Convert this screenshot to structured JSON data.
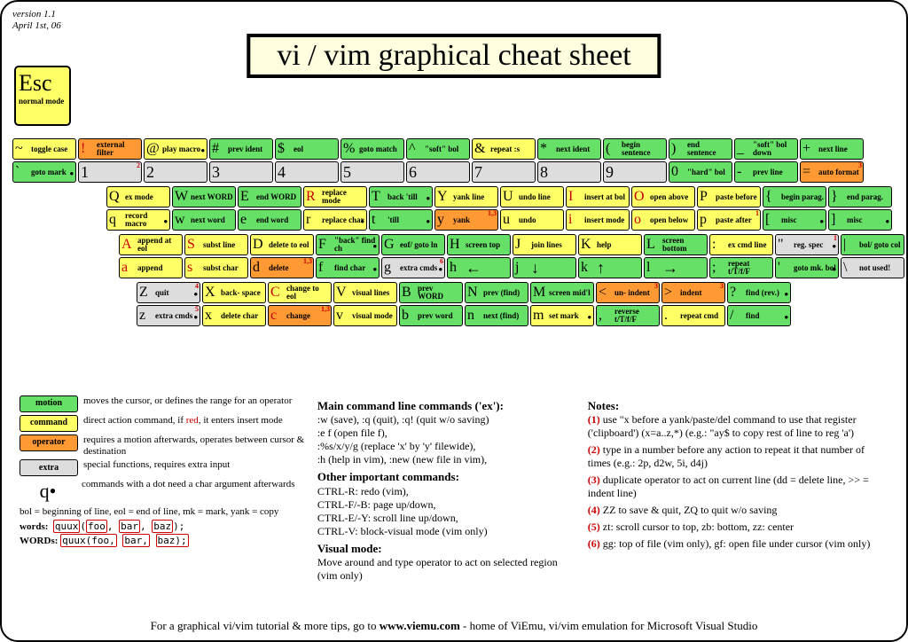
{
  "version": "version 1.1",
  "date": "April 1st, 06",
  "title": "vi / vim graphical cheat sheet",
  "esc": {
    "big": "Esc",
    "sm": "normal mode"
  },
  "rows": [
    {
      "ind": "",
      "keys": [
        {
          "t": [
            {
              "c": "~",
              "l": "toggle case",
              "cls": "y"
            }
          ],
          "b": [
            {
              "c": "`",
              "l": "goto mark",
              "cls": "g",
              "dot": 1
            }
          ]
        },
        {
          "t": [
            {
              "c": "!",
              "l": "external filter",
              "cls": "o",
              "red": 1
            }
          ],
          "tall": {
            "c": "1",
            "cls": "gr",
            "sup": "2"
          }
        },
        {
          "t": [
            {
              "c": "@",
              "l": "play macro",
              "cls": "y",
              "dot": 1
            }
          ],
          "tall": {
            "c": "2",
            "cls": "gr"
          }
        },
        {
          "t": [
            {
              "c": "#",
              "l": "prev ident",
              "cls": "g"
            }
          ],
          "tall": {
            "c": "3",
            "cls": "gr"
          }
        },
        {
          "t": [
            {
              "c": "$",
              "l": "eol",
              "cls": "g"
            }
          ],
          "tall": {
            "c": "4",
            "cls": "gr"
          }
        },
        {
          "t": [
            {
              "c": "%",
              "l": "goto match",
              "cls": "g"
            }
          ],
          "tall": {
            "c": "5",
            "cls": "gr"
          }
        },
        {
          "t": [
            {
              "c": "^",
              "l": "\"soft\" bol",
              "cls": "g"
            }
          ],
          "tall": {
            "c": "6",
            "cls": "gr"
          }
        },
        {
          "t": [
            {
              "c": "&",
              "l": "repeat :s",
              "cls": "y"
            }
          ],
          "tall": {
            "c": "7",
            "cls": "gr"
          }
        },
        {
          "t": [
            {
              "c": "*",
              "l": "next ident",
              "cls": "g"
            }
          ],
          "tall": {
            "c": "8",
            "cls": "gr"
          }
        },
        {
          "t": [
            {
              "c": "(",
              "l": "begin sentence",
              "cls": "g"
            }
          ],
          "tall": {
            "c": "9",
            "cls": "gr"
          }
        },
        {
          "t": [
            {
              "c": ")",
              "l": "end sentence",
              "cls": "g"
            }
          ],
          "b": [
            {
              "c": "0",
              "l": "\"hard\" bol",
              "cls": "g"
            }
          ]
        },
        {
          "t": [
            {
              "c": "_",
              "l": "\"soft\" bol down",
              "cls": "g"
            }
          ],
          "b": [
            {
              "c": "-",
              "l": "prev line",
              "cls": "g"
            }
          ]
        },
        {
          "t": [
            {
              "c": "+",
              "l": "next line",
              "cls": "g"
            }
          ],
          "b": [
            {
              "c": "=",
              "l": "auto format",
              "cls": "o",
              "sup": "3"
            }
          ]
        }
      ]
    },
    {
      "ind": "i1",
      "keys": [
        {
          "t": [
            {
              "c": "Q",
              "l": "ex mode",
              "cls": "y"
            }
          ],
          "b": [
            {
              "c": "q",
              "l": "record macro",
              "cls": "y",
              "dot": 1
            }
          ]
        },
        {
          "t": [
            {
              "c": "W",
              "l": "next WORD",
              "cls": "g"
            }
          ],
          "b": [
            {
              "c": "w",
              "l": "next word",
              "cls": "g"
            }
          ]
        },
        {
          "t": [
            {
              "c": "E",
              "l": "end WORD",
              "cls": "g"
            }
          ],
          "b": [
            {
              "c": "e",
              "l": "end word",
              "cls": "g"
            }
          ]
        },
        {
          "t": [
            {
              "c": "R",
              "l": "replace mode",
              "cls": "y",
              "red": 1
            }
          ],
          "b": [
            {
              "c": "r",
              "l": "replace char",
              "cls": "y",
              "dot": 1
            }
          ]
        },
        {
          "t": [
            {
              "c": "T",
              "l": "back 'till",
              "cls": "g",
              "dot": 1
            }
          ],
          "b": [
            {
              "c": "t",
              "l": "'till",
              "cls": "g",
              "dot": 1
            }
          ]
        },
        {
          "t": [
            {
              "c": "Y",
              "l": "yank line",
              "cls": "y"
            }
          ],
          "b": [
            {
              "c": "y",
              "l": "yank",
              "cls": "o",
              "sup": "1,3"
            }
          ]
        },
        {
          "t": [
            {
              "c": "U",
              "l": "undo line",
              "cls": "y"
            }
          ],
          "b": [
            {
              "c": "u",
              "l": "undo",
              "cls": "y"
            }
          ]
        },
        {
          "t": [
            {
              "c": "I",
              "l": "insert at bol",
              "cls": "y",
              "red": 1
            }
          ],
          "b": [
            {
              "c": "i",
              "l": "insert mode",
              "cls": "y",
              "red": 1
            }
          ]
        },
        {
          "t": [
            {
              "c": "O",
              "l": "open above",
              "cls": "y",
              "red": 1
            }
          ],
          "b": [
            {
              "c": "o",
              "l": "open below",
              "cls": "y",
              "red": 1
            }
          ]
        },
        {
          "t": [
            {
              "c": "P",
              "l": "paste before",
              "cls": "y"
            }
          ],
          "b": [
            {
              "c": "p",
              "l": "paste after",
              "cls": "y",
              "sup": "1"
            }
          ]
        },
        {
          "t": [
            {
              "c": "{",
              "l": "begin parag.",
              "cls": "g"
            }
          ],
          "b": [
            {
              "c": "[",
              "l": "misc",
              "cls": "g",
              "dot": 1
            }
          ]
        },
        {
          "t": [
            {
              "c": "}",
              "l": "end parag.",
              "cls": "g"
            }
          ],
          "b": [
            {
              "c": "]",
              "l": "misc",
              "cls": "g",
              "dot": 1
            }
          ]
        }
      ]
    },
    {
      "ind": "i2",
      "keys": [
        {
          "t": [
            {
              "c": "A",
              "l": "append at eol",
              "cls": "y",
              "red": 1
            }
          ],
          "b": [
            {
              "c": "a",
              "l": "append",
              "cls": "y",
              "red": 1
            }
          ]
        },
        {
          "t": [
            {
              "c": "S",
              "l": "subst line",
              "cls": "y",
              "red": 1
            }
          ],
          "b": [
            {
              "c": "s",
              "l": "subst char",
              "cls": "y",
              "red": 1
            }
          ]
        },
        {
          "t": [
            {
              "c": "D",
              "l": "delete to eol",
              "cls": "y"
            }
          ],
          "b": [
            {
              "c": "d",
              "l": "delete",
              "cls": "o",
              "sup": "1,3"
            }
          ]
        },
        {
          "t": [
            {
              "c": "F",
              "l": "\"back\" find ch",
              "cls": "g",
              "dot": 1
            }
          ],
          "b": [
            {
              "c": "f",
              "l": "find char",
              "cls": "g",
              "dot": 1
            }
          ]
        },
        {
          "t": [
            {
              "c": "G",
              "l": "eof/ goto ln",
              "cls": "g"
            }
          ],
          "b": [
            {
              "c": "g",
              "l": "extra cmds",
              "cls": "gr",
              "dot": 1,
              "sup": "6"
            }
          ]
        },
        {
          "t": [
            {
              "c": "H",
              "l": "screen top",
              "cls": "g"
            }
          ],
          "b": [
            {
              "c": "h",
              "l": "←",
              "cls": "g",
              "arrow": 1
            }
          ]
        },
        {
          "t": [
            {
              "c": "J",
              "l": "join lines",
              "cls": "y"
            }
          ],
          "b": [
            {
              "c": "j",
              "l": "↓",
              "cls": "g",
              "arrow": 1
            }
          ]
        },
        {
          "t": [
            {
              "c": "K",
              "l": "help",
              "cls": "y"
            }
          ],
          "b": [
            {
              "c": "k",
              "l": "↑",
              "cls": "g",
              "arrow": 1
            }
          ]
        },
        {
          "t": [
            {
              "c": "L",
              "l": "screen bottom",
              "cls": "g"
            }
          ],
          "b": [
            {
              "c": "l",
              "l": "→",
              "cls": "g",
              "arrow": 1
            }
          ]
        },
        {
          "t": [
            {
              "c": ":",
              "l": "ex cmd line",
              "cls": "y"
            }
          ],
          "b": [
            {
              "c": ";",
              "l": "repeat t/T/f/F",
              "cls": "g"
            }
          ]
        },
        {
          "t": [
            {
              "c": "\"",
              "l": "reg. spec",
              "cls": "gr",
              "dot": 1,
              "sup": "1"
            }
          ],
          "b": [
            {
              "c": "'",
              "l": "goto mk. bol",
              "cls": "g",
              "dot": 1
            }
          ]
        },
        {
          "t": [
            {
              "c": "|",
              "l": "bol/ goto col",
              "cls": "g"
            }
          ],
          "b": [
            {
              "c": "\\",
              "l": "not used!",
              "cls": "gr"
            }
          ]
        }
      ]
    },
    {
      "ind": "i3",
      "keys": [
        {
          "t": [
            {
              "c": "Z",
              "l": "quit",
              "cls": "gr",
              "dot": 1,
              "sup": "4"
            }
          ],
          "b": [
            {
              "c": "z",
              "l": "extra cmds",
              "cls": "gr",
              "dot": 1,
              "sup": "5"
            }
          ]
        },
        {
          "t": [
            {
              "c": "X",
              "l": "back- space",
              "cls": "y"
            }
          ],
          "b": [
            {
              "c": "x",
              "l": "delete char",
              "cls": "y"
            }
          ]
        },
        {
          "t": [
            {
              "c": "C",
              "l": "change to eol",
              "cls": "y",
              "red": 1
            }
          ],
          "b": [
            {
              "c": "c",
              "l": "change",
              "cls": "o",
              "red": 1,
              "sup": "1,3"
            }
          ]
        },
        {
          "t": [
            {
              "c": "V",
              "l": "visual lines",
              "cls": "y"
            }
          ],
          "b": [
            {
              "c": "v",
              "l": "visual mode",
              "cls": "y"
            }
          ]
        },
        {
          "t": [
            {
              "c": "B",
              "l": "prev WORD",
              "cls": "g"
            }
          ],
          "b": [
            {
              "c": "b",
              "l": "prev word",
              "cls": "g"
            }
          ]
        },
        {
          "t": [
            {
              "c": "N",
              "l": "prev (find)",
              "cls": "g"
            }
          ],
          "b": [
            {
              "c": "n",
              "l": "next (find)",
              "cls": "g"
            }
          ]
        },
        {
          "t": [
            {
              "c": "M",
              "l": "screen mid'l",
              "cls": "g"
            }
          ],
          "b": [
            {
              "c": "m",
              "l": "set mark",
              "cls": "y",
              "dot": 1
            }
          ]
        },
        {
          "t": [
            {
              "c": "<",
              "l": "un- indent",
              "cls": "o",
              "sup": "3"
            }
          ],
          "b": [
            {
              "c": ",",
              "l": "reverse t/T/f/F",
              "cls": "g"
            }
          ]
        },
        {
          "t": [
            {
              "c": ">",
              "l": "indent",
              "cls": "o",
              "sup": "3"
            }
          ],
          "b": [
            {
              "c": ".",
              "l": "repeat cmd",
              "cls": "y"
            }
          ]
        },
        {
          "t": [
            {
              "c": "?",
              "l": "find (rev.)",
              "cls": "g",
              "dot": 1
            }
          ],
          "b": [
            {
              "c": "/",
              "l": "find",
              "cls": "g",
              "dot": 1
            }
          ]
        }
      ]
    }
  ],
  "legend": [
    {
      "box": "motion",
      "cls": "g",
      "txt": "moves the cursor, or defines the range for an operator"
    },
    {
      "box": "command",
      "cls": "y",
      "txt": "direct action command, if red, it enters insert mode"
    },
    {
      "box": "operator",
      "cls": "o",
      "txt": "requires a motion afterwards, operates between cursor & destination"
    },
    {
      "box": "extra",
      "cls": "gr",
      "txt": "special functions, requires extra input"
    }
  ],
  "qdot": "commands with a dot need a char argument afterwards",
  "bol": "bol = beginning of line, eol = end of line, mk = mark, yank = copy",
  "words_label": "words:",
  "words_ex": "quux(foo, bar, baz);",
  "WORDS_label": "WORDs:",
  "WORDS_ex": "quux(foo, bar, baz);",
  "main_hd": "Main command line commands ('ex'):",
  "main": [
    ":w (save), :q (quit), :q! (quit w/o saving)",
    ":e f (open file f),",
    ":%s/x/y/g (replace 'x' by 'y' filewide),",
    ":h (help in vim), :new (new file in vim),"
  ],
  "other_hd": "Other important commands:",
  "other": [
    "CTRL-R: redo (vim),",
    "CTRL-F/-B: page up/down,",
    "CTRL-E/-Y: scroll line up/down,",
    "CTRL-V: block-visual mode (vim only)"
  ],
  "vis_hd": "Visual mode:",
  "vis": "Move around and type operator to act on selected region (vim only)",
  "notes_hd": "Notes:",
  "notes": [
    {
      "n": "(1)",
      "t": "use \"x before a yank/paste/del command to use that register ('clipboard') (x=a..z,*) (e.g.: \"ay$ to copy rest of line to reg 'a')"
    },
    {
      "n": "(2)",
      "t": "type in a number before any action to repeat it that number of times (e.g.: 2p, d2w, 5i, d4j)"
    },
    {
      "n": "(3)",
      "t": "duplicate operator to act on current line (dd = delete line, >> = indent line)"
    },
    {
      "n": "(4)",
      "t": "ZZ to save & quit, ZQ to quit w/o saving"
    },
    {
      "n": "(5)",
      "t": "zt: scroll cursor to top, zb: bottom, zz: center"
    },
    {
      "n": "(6)",
      "t": "gg: top of file (vim only), gf: open file under cursor (vim only)"
    }
  ],
  "footer1": "For a graphical vi/vim tutorial & more tips, go to ",
  "footer2": "www.viemu.com",
  "footer3": " - home of ViEmu, vi/vim emulation for Microsoft Visual Studio"
}
